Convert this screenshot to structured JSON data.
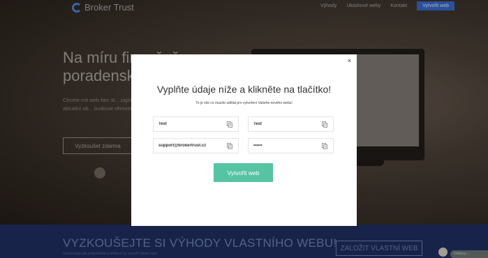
{
  "background": {
    "brand": "Broker Trust",
    "nav": [
      "Výhody",
      "Ukázkové weby",
      "Kontakt"
    ],
    "nav_cta": "Vytvořit web",
    "hero_title": "Na míru finančně poradensky",
    "hero_desc": "Chcete mít web bez st... zajímavý a aktuální ob... budovat věrnost Vaši...",
    "hero_button": "Vyzkoušet zdarma",
    "footer_title": "VYZKOUŠEJTE SI VÝHODY VLASTNÍHO WEBU!",
    "footer_sub": "Vyzkoušejte jak jednoduché a efektivní je vytvořit vlastní web",
    "footer_button": "ZALOŽIT VLASTNÍ WEB",
    "chat_label": "Dotazy..."
  },
  "modal": {
    "close": "×",
    "title": "Vyplňte údaje níže a klikněte na tlačítko!",
    "subtitle": "To je vše co musíte udělat pro vytvoření Vašeho nového webu!",
    "fields": [
      {
        "value": "Test",
        "type": "text"
      },
      {
        "value": "Test",
        "type": "text"
      },
      {
        "value": "support@brokertrust.cz",
        "type": "email"
      },
      {
        "value": "••••••",
        "type": "password"
      }
    ],
    "submit": "Vytvořit web"
  },
  "colors": {
    "accent": "#56c4a2",
    "footer": "#1a2750",
    "brand_blue": "#2f56a8"
  }
}
